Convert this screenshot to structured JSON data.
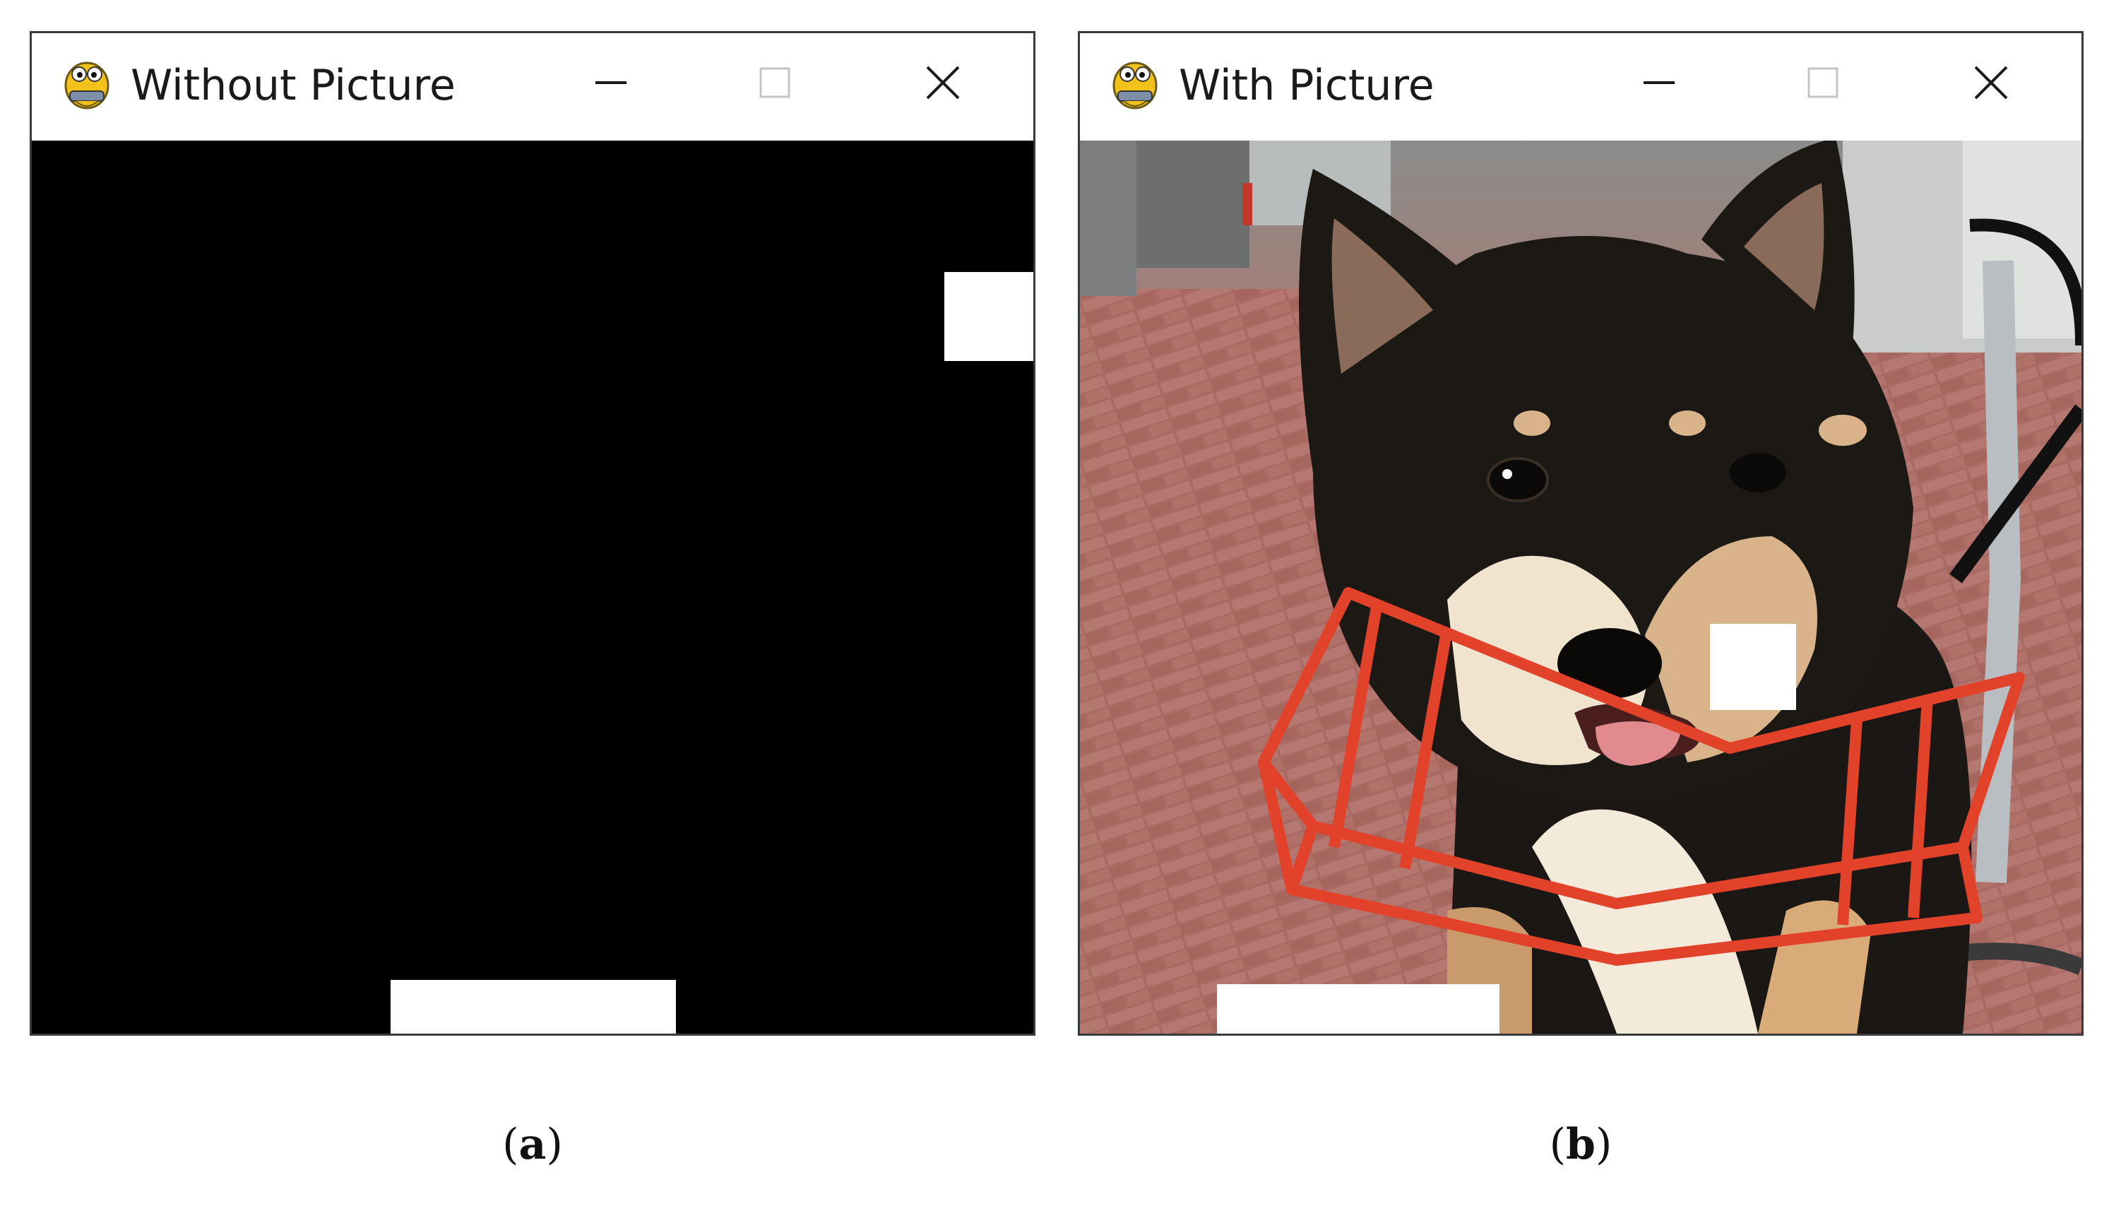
{
  "panels": [
    {
      "id": "a",
      "window": {
        "title": "Without Picture",
        "app_icon": "pygame-snake-icon",
        "controls": [
          "minimize-icon",
          "maximize-icon",
          "close-icon"
        ]
      },
      "background": "black",
      "caption": {
        "open": "(",
        "letter": "a",
        "close": ")"
      }
    },
    {
      "id": "b",
      "window": {
        "title": "With Picture",
        "app_icon": "pygame-snake-icon",
        "controls": [
          "minimize-icon",
          "maximize-icon",
          "close-icon"
        ]
      },
      "background": "photo of a black-and-tan shiba inu dog sitting in a red bicycle basket",
      "caption": {
        "open": "(",
        "letter": "b",
        "close": ")"
      }
    }
  ],
  "colors": {
    "titlebar": "#ffffff",
    "border": "#3a3a3a",
    "game_background_a": "#000000",
    "brick": "#ffffff",
    "paddle": "#ffffff",
    "basket": "#e2412a"
  }
}
